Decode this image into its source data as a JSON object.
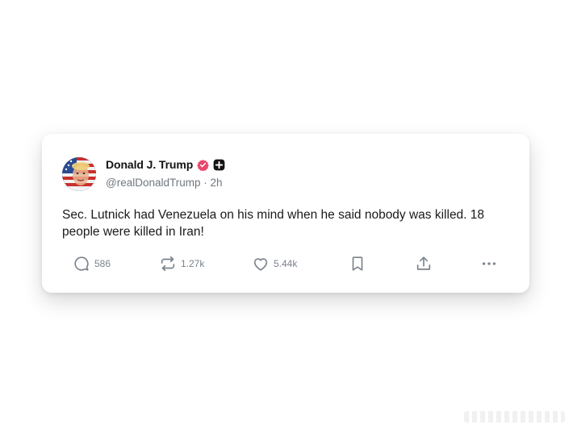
{
  "author": {
    "display_name": "Donald J. Trump",
    "handle": "@realDonaldTrump",
    "separator": "·",
    "time": "2h",
    "verified_icon": "verified-badge-icon",
    "affiliate_icon": "plus-badge-icon"
  },
  "post": {
    "text": "Sec. Lutnick had Venezuela on his mind when he said nobody was killed. 18 people were killed in Iran!"
  },
  "actions": {
    "replies": {
      "icon": "reply-icon",
      "count": "586"
    },
    "reposts": {
      "icon": "repost-icon",
      "count": "1.27k"
    },
    "likes": {
      "icon": "like-icon",
      "count": "5.44k"
    },
    "bookmark": {
      "icon": "bookmark-icon"
    },
    "share": {
      "icon": "share-icon"
    },
    "more": {
      "icon": "more-icon"
    }
  },
  "colors": {
    "verified": "#e8476b",
    "icon": "#7a828c",
    "text": "#1a1a1a"
  }
}
